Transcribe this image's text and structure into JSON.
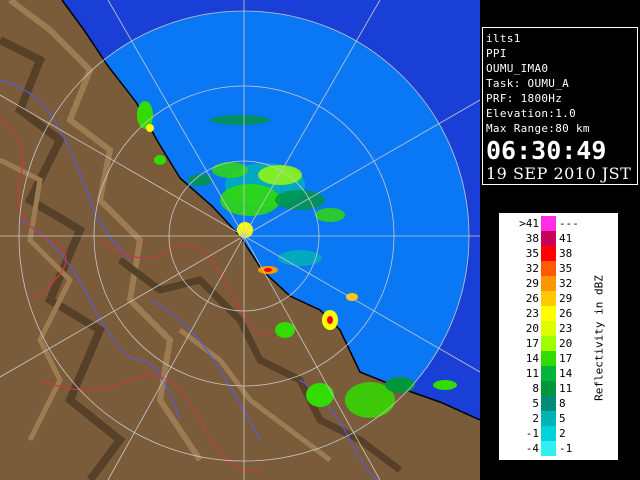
{
  "radar": {
    "land_color": "#7a5c3a",
    "echo_area_color": "#0a78f5",
    "outer_ring_color": "#1a3fd6",
    "range_ring_color": "#c8c8c8",
    "coastline_color": "#000000"
  },
  "info": {
    "lines": [
      "ilts1",
      "PPI",
      "OUMU_IMA0",
      "Task: OUMU_A",
      "PRF: 1800Hz",
      "Elevation:1.0",
      "Max Range:80 km"
    ],
    "time": "06:30:49",
    "date": "19 SEP 2010 JST"
  },
  "legend": {
    "title": "Reflectivity in dBZ",
    "rows": [
      {
        "lo": ">41",
        "hi": "---",
        "color": "#ff2ee6"
      },
      {
        "lo": "38",
        "hi": "41",
        "color": "#c8005a"
      },
      {
        "lo": "35",
        "hi": "38",
        "color": "#ff0000"
      },
      {
        "lo": "32",
        "hi": "35",
        "color": "#ff5a00"
      },
      {
        "lo": "29",
        "hi": "32",
        "color": "#ff9600"
      },
      {
        "lo": "26",
        "hi": "29",
        "color": "#ffc800"
      },
      {
        "lo": "23",
        "hi": "26",
        "color": "#ffff00"
      },
      {
        "lo": "20",
        "hi": "23",
        "color": "#dcff00"
      },
      {
        "lo": "17",
        "hi": "20",
        "color": "#a0ff00"
      },
      {
        "lo": "14",
        "hi": "17",
        "color": "#32dc00"
      },
      {
        "lo": "11",
        "hi": "14",
        "color": "#00b43c"
      },
      {
        "lo": "8",
        "hi": "11",
        "color": "#00963c"
      },
      {
        "lo": "5",
        "hi": "8",
        "color": "#008c78"
      },
      {
        "lo": "2",
        "hi": "5",
        "color": "#00b4b4"
      },
      {
        "lo": "-1",
        "hi": "2",
        "color": "#00d2dc"
      },
      {
        "lo": "-4",
        "hi": "-1",
        "color": "#32f0f0"
      }
    ]
  }
}
